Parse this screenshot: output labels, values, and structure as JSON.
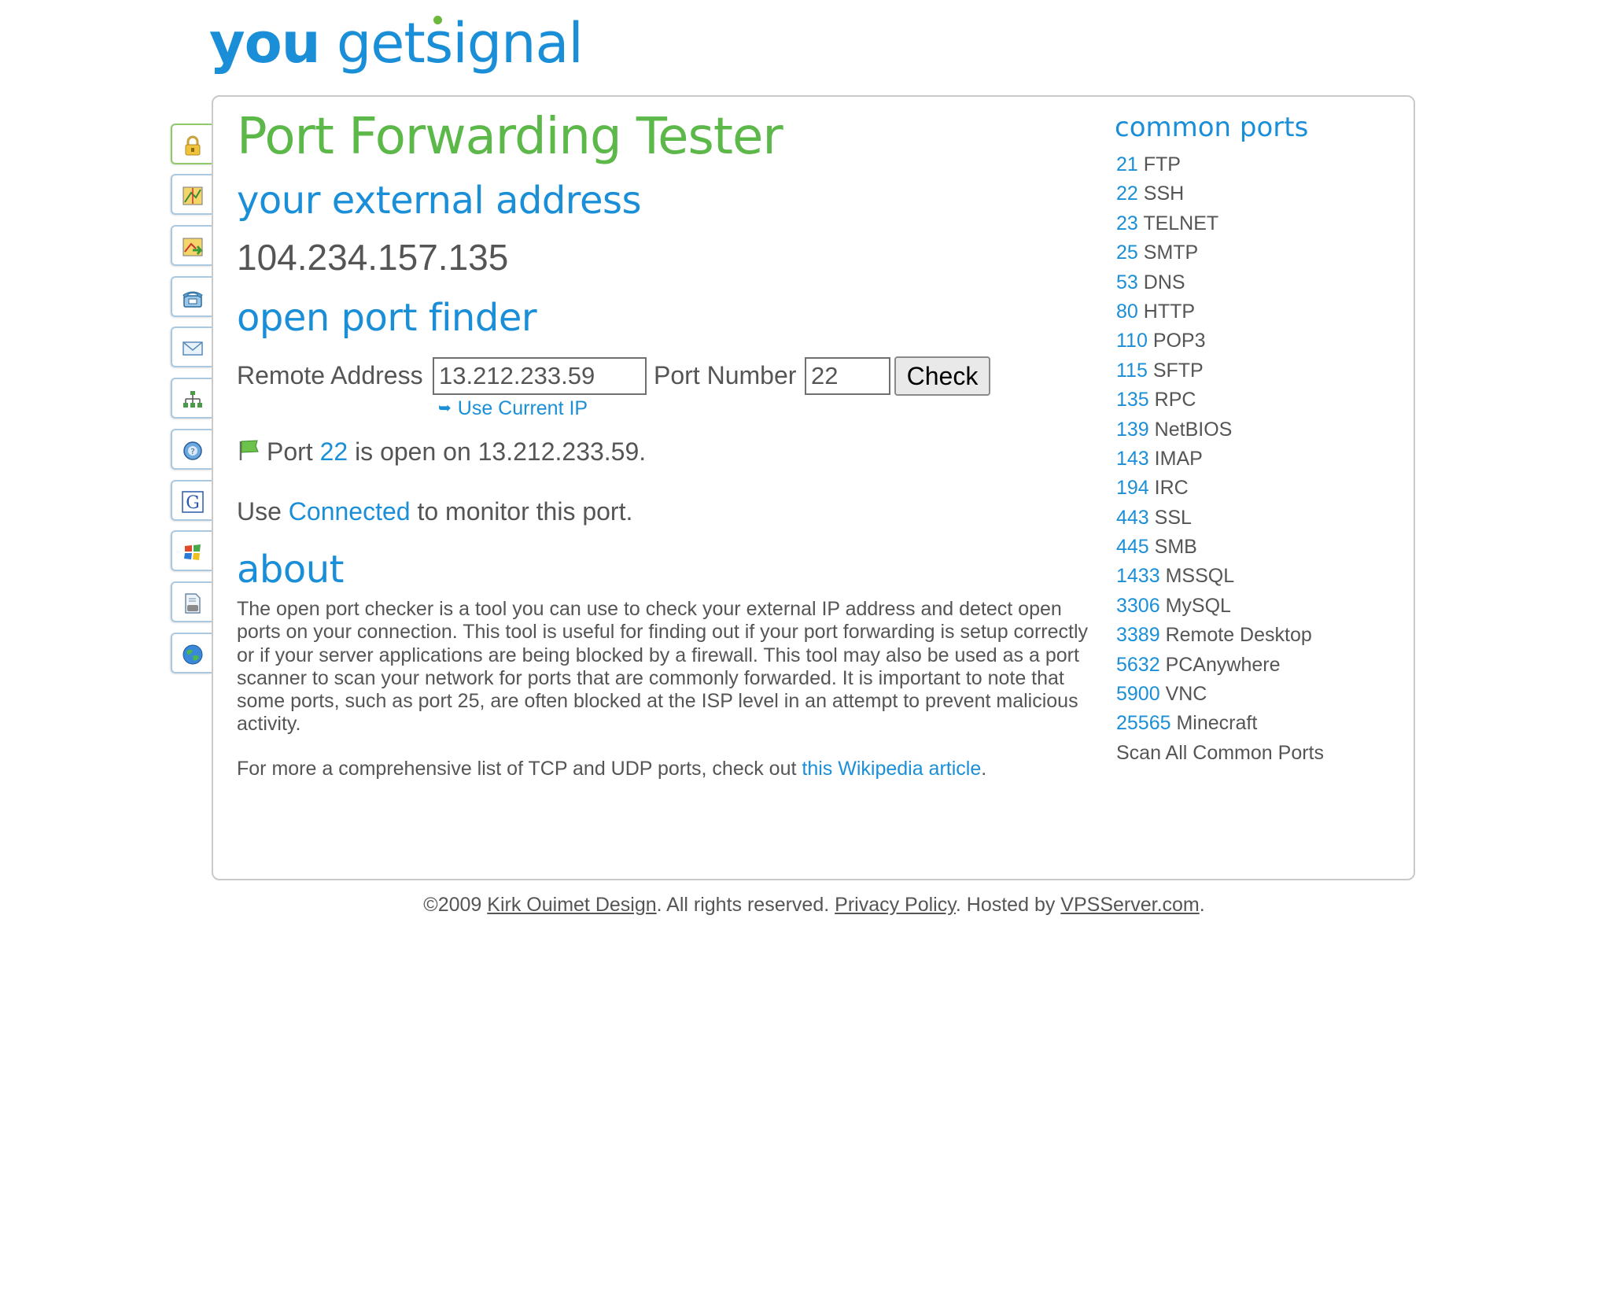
{
  "logo": {
    "you": "you",
    "get": "get",
    "signal": "signal"
  },
  "sidebar": {
    "tabs": [
      {
        "icon": "padlock-icon"
      },
      {
        "icon": "map-icon"
      },
      {
        "icon": "map-arrow-icon"
      },
      {
        "icon": "phone-icon"
      },
      {
        "icon": "envelope-icon"
      },
      {
        "icon": "network-icon"
      },
      {
        "icon": "globe-question-icon"
      },
      {
        "icon": "google-icon"
      },
      {
        "icon": "windows-icon"
      },
      {
        "icon": "document-icon"
      },
      {
        "icon": "earth-icon"
      }
    ]
  },
  "main": {
    "title": "Port Forwarding Tester",
    "external_heading": "your external address",
    "external_ip": "104.234.157.135",
    "finder_heading": "open port finder",
    "remote_label": "Remote Address",
    "remote_value": "13.212.233.59",
    "port_label": "Port Number",
    "port_value": "22",
    "check_label": "Check",
    "use_current_ip": "Use Current IP",
    "result": {
      "prefix": "Port",
      "port": "22",
      "suffix": "is open on 13.212.233.59."
    },
    "monitor": {
      "prefix": "Use",
      "link": "Connected",
      "suffix": "to monitor this port."
    },
    "about_heading": "about",
    "about_text": "The open port checker is a tool you can use to check your external IP address and detect open ports on your connection. This tool is useful for finding out if your port forwarding is setup correctly or if your server applications are being blocked by a firewall. This tool may also be used as a port scanner to scan your network for ports that are commonly forwarded. It is important to note that some ports, such as port 25, are often blocked at the ISP level in an attempt to prevent malicious activity.",
    "more": {
      "prefix": "For more a comprehensive list of TCP and UDP ports, check out",
      "link": "this Wikipedia article",
      "suffix": "."
    }
  },
  "common_ports": {
    "title": "common ports",
    "items": [
      {
        "num": "21",
        "name": "FTP"
      },
      {
        "num": "22",
        "name": "SSH"
      },
      {
        "num": "23",
        "name": "TELNET"
      },
      {
        "num": "25",
        "name": "SMTP"
      },
      {
        "num": "53",
        "name": "DNS"
      },
      {
        "num": "80",
        "name": "HTTP"
      },
      {
        "num": "110",
        "name": "POP3"
      },
      {
        "num": "115",
        "name": "SFTP"
      },
      {
        "num": "135",
        "name": "RPC"
      },
      {
        "num": "139",
        "name": "NetBIOS"
      },
      {
        "num": "143",
        "name": "IMAP"
      },
      {
        "num": "194",
        "name": "IRC"
      },
      {
        "num": "443",
        "name": "SSL"
      },
      {
        "num": "445",
        "name": "SMB"
      },
      {
        "num": "1433",
        "name": "MSSQL"
      },
      {
        "num": "3306",
        "name": "MySQL"
      },
      {
        "num": "3389",
        "name": "Remote Desktop"
      },
      {
        "num": "5632",
        "name": "PCAnywhere"
      },
      {
        "num": "5900",
        "name": "VNC"
      },
      {
        "num": "25565",
        "name": "Minecraft"
      }
    ],
    "scan_all": "Scan All Common Ports"
  },
  "footer": {
    "copyright": "©2009",
    "author": "Kirk Ouimet Design",
    "rights": ". All rights reserved.",
    "privacy": "Privacy Policy",
    "hosted": ". Hosted by",
    "host": "VPSServer.com",
    "end": "."
  },
  "colors": {
    "blue": "#1a8fd8",
    "green": "#5db84a",
    "text": "#555555"
  }
}
